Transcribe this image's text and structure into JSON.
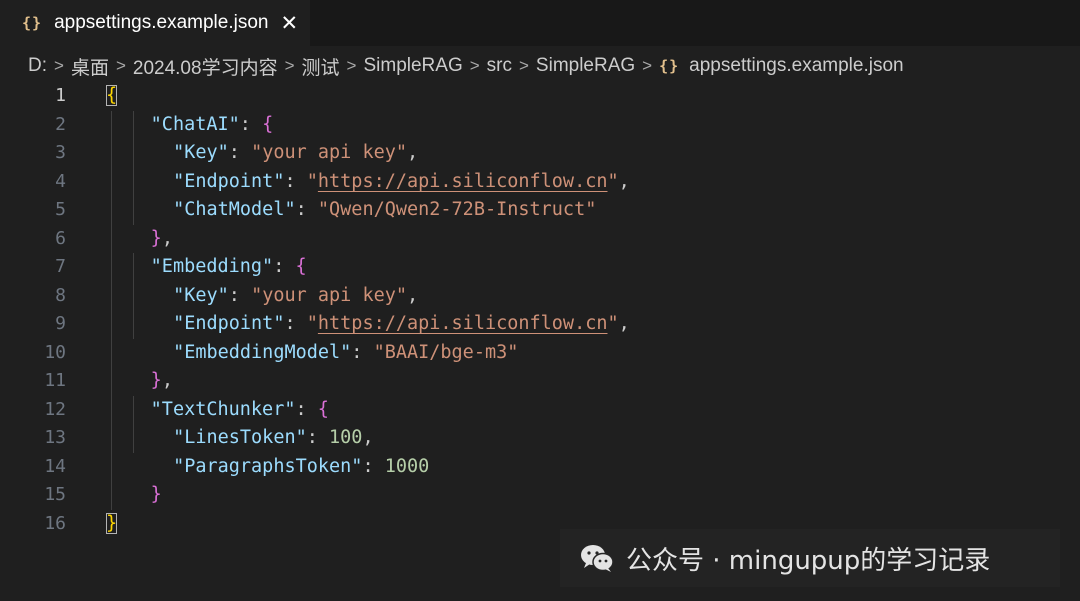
{
  "tab": {
    "icon": "{}",
    "icon_name": "json-braces-icon",
    "label": "appsettings.example.json",
    "close": "✕"
  },
  "breadcrumb": {
    "items": [
      "D:",
      "桌面",
      "2024.08学习内容",
      "测试",
      "SimpleRAG",
      "src",
      "SimpleRAG"
    ],
    "file_icon": "{}",
    "file": "appsettings.example.json",
    "separator": ">"
  },
  "editor": {
    "active_line": 1,
    "lines": [
      {
        "n": "1",
        "tokens": [
          {
            "t": "{",
            "c": "b1 bracket-match"
          }
        ]
      },
      {
        "n": "2",
        "tokens": [
          {
            "t": "  "
          },
          {
            "t": "\"ChatAI\"",
            "c": "key"
          },
          {
            "t": ": ",
            "c": "punc"
          },
          {
            "t": "{",
            "c": "b2"
          }
        ]
      },
      {
        "n": "3",
        "tokens": [
          {
            "t": "  "
          },
          {
            "t": "\"Key\"",
            "c": "key"
          },
          {
            "t": ": ",
            "c": "punc"
          },
          {
            "t": "\"your api key\"",
            "c": "str"
          },
          {
            "t": ",",
            "c": "punc"
          }
        ]
      },
      {
        "n": "4",
        "tokens": [
          {
            "t": "  "
          },
          {
            "t": "\"Endpoint\"",
            "c": "key"
          },
          {
            "t": ": ",
            "c": "punc"
          },
          {
            "t": "\"",
            "c": "str"
          },
          {
            "t": "https://api.siliconflow.cn",
            "c": "str link"
          },
          {
            "t": "\"",
            "c": "str"
          },
          {
            "t": ",",
            "c": "punc"
          }
        ]
      },
      {
        "n": "5",
        "tokens": [
          {
            "t": "  "
          },
          {
            "t": "\"ChatModel\"",
            "c": "key"
          },
          {
            "t": ": ",
            "c": "punc"
          },
          {
            "t": "\"Qwen/Qwen2-72B-Instruct\"",
            "c": "str"
          }
        ]
      },
      {
        "n": "6",
        "tokens": [
          {
            "t": "  "
          },
          {
            "t": "}",
            "c": "b2"
          },
          {
            "t": ",",
            "c": "punc"
          }
        ]
      },
      {
        "n": "7",
        "tokens": [
          {
            "t": "  "
          },
          {
            "t": "\"Embedding\"",
            "c": "key"
          },
          {
            "t": ": ",
            "c": "punc"
          },
          {
            "t": "{",
            "c": "b2"
          }
        ]
      },
      {
        "n": "8",
        "tokens": [
          {
            "t": "  "
          },
          {
            "t": "\"Key\"",
            "c": "key"
          },
          {
            "t": ": ",
            "c": "punc"
          },
          {
            "t": "\"your api key\"",
            "c": "str"
          },
          {
            "t": ",",
            "c": "punc"
          }
        ]
      },
      {
        "n": "9",
        "tokens": [
          {
            "t": "  "
          },
          {
            "t": "\"Endpoint\"",
            "c": "key"
          },
          {
            "t": ": ",
            "c": "punc"
          },
          {
            "t": "\"",
            "c": "str"
          },
          {
            "t": "https://api.siliconflow.cn",
            "c": "str link"
          },
          {
            "t": "\"",
            "c": "str"
          },
          {
            "t": ",",
            "c": "punc"
          }
        ]
      },
      {
        "n": "10",
        "tokens": [
          {
            "t": "  "
          },
          {
            "t": "\"EmbeddingModel\"",
            "c": "key"
          },
          {
            "t": ": ",
            "c": "punc"
          },
          {
            "t": "\"BAAI/bge-m3\"",
            "c": "str"
          }
        ]
      },
      {
        "n": "11",
        "tokens": [
          {
            "t": "  "
          },
          {
            "t": "}",
            "c": "b2"
          },
          {
            "t": ",",
            "c": "punc"
          }
        ]
      },
      {
        "n": "12",
        "tokens": [
          {
            "t": "  "
          },
          {
            "t": "\"TextChunker\"",
            "c": "key"
          },
          {
            "t": ": ",
            "c": "punc"
          },
          {
            "t": "{",
            "c": "b2"
          }
        ]
      },
      {
        "n": "13",
        "tokens": [
          {
            "t": "  "
          },
          {
            "t": "\"LinesToken\"",
            "c": "key"
          },
          {
            "t": ": ",
            "c": "punc"
          },
          {
            "t": "100",
            "c": "num"
          },
          {
            "t": ",",
            "c": "punc"
          }
        ]
      },
      {
        "n": "14",
        "tokens": [
          {
            "t": "  "
          },
          {
            "t": "\"ParagraphsToken\"",
            "c": "key"
          },
          {
            "t": ": ",
            "c": "punc"
          },
          {
            "t": "1000",
            "c": "num"
          }
        ]
      },
      {
        "n": "15",
        "tokens": [
          {
            "t": "  "
          },
          {
            "t": "}",
            "c": "b2"
          }
        ]
      },
      {
        "n": "16",
        "tokens": [
          {
            "t": "}",
            "c": "b1 bracket-match"
          }
        ]
      }
    ]
  },
  "watermark": {
    "icon_name": "wechat-icon",
    "text": "公众号 · mingupup的学习记录"
  },
  "colors": {
    "background": "#1f1f1f",
    "key": "#9cdcfe",
    "string": "#ce9178",
    "number": "#b5cea8",
    "bracket_level1": "#ffd700",
    "bracket_level2": "#da70d6"
  }
}
